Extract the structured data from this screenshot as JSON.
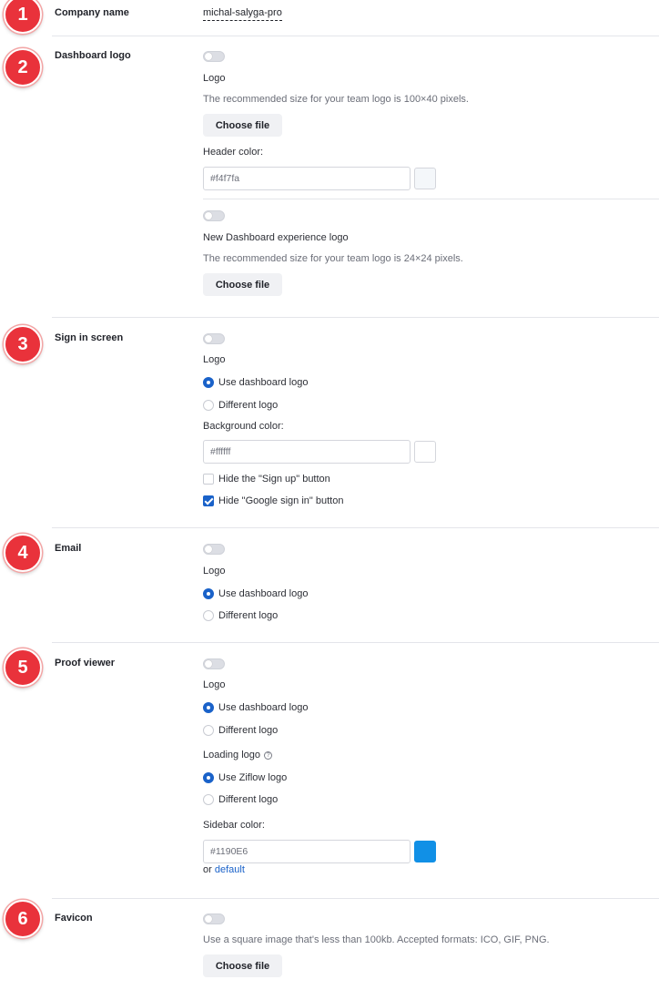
{
  "badges": [
    "1",
    "2",
    "3",
    "4",
    "5",
    "6"
  ],
  "company": {
    "label": "Company name",
    "value": "michal-salyga-pro"
  },
  "dashboard_logo": {
    "label": "Dashboard logo",
    "logo_label": "Logo",
    "logo_hint": "The recommended size for your team logo is 100×40 pixels.",
    "choose_file": "Choose file",
    "header_color_label": "Header color:",
    "header_color_value": "#f4f7fa",
    "header_color_swatch": "#f4f7fa",
    "new_logo_label": "New Dashboard experience logo",
    "new_logo_hint": "The recommended size for your team logo is 24×24 pixels.",
    "new_choose_file": "Choose file"
  },
  "sign_in": {
    "label": "Sign in screen",
    "logo_label": "Logo",
    "use_dashboard_logo": "Use dashboard logo",
    "different_logo": "Different logo",
    "bg_color_label": "Background color:",
    "bg_color_value": "#ffffff",
    "bg_color_swatch": "#ffffff",
    "hide_signup": "Hide the \"Sign up\" button",
    "hide_google": "Hide \"Google sign in\" button"
  },
  "email": {
    "label": "Email",
    "logo_label": "Logo",
    "use_dashboard_logo": "Use dashboard logo",
    "different_logo": "Different logo"
  },
  "proof_viewer": {
    "label": "Proof viewer",
    "logo_label": "Logo",
    "use_dashboard_logo": "Use dashboard logo",
    "different_logo": "Different logo",
    "loading_logo_label": "Loading logo",
    "loading_help": "?",
    "use_ziflow_logo": "Use Ziflow logo",
    "loading_different_logo": "Different logo",
    "sidebar_color_label": "Sidebar color:",
    "sidebar_color_value": "#1190E6",
    "sidebar_color_swatch": "#1190E6",
    "or_text": "or",
    "default_link": "default"
  },
  "favicon": {
    "label": "Favicon",
    "hint": "Use a square image that's less than 100kb. Accepted formats: ICO, GIF, PNG.",
    "choose_file": "Choose file"
  },
  "colors": {
    "accent": "#1a62c9",
    "badge": "#e9323b"
  }
}
